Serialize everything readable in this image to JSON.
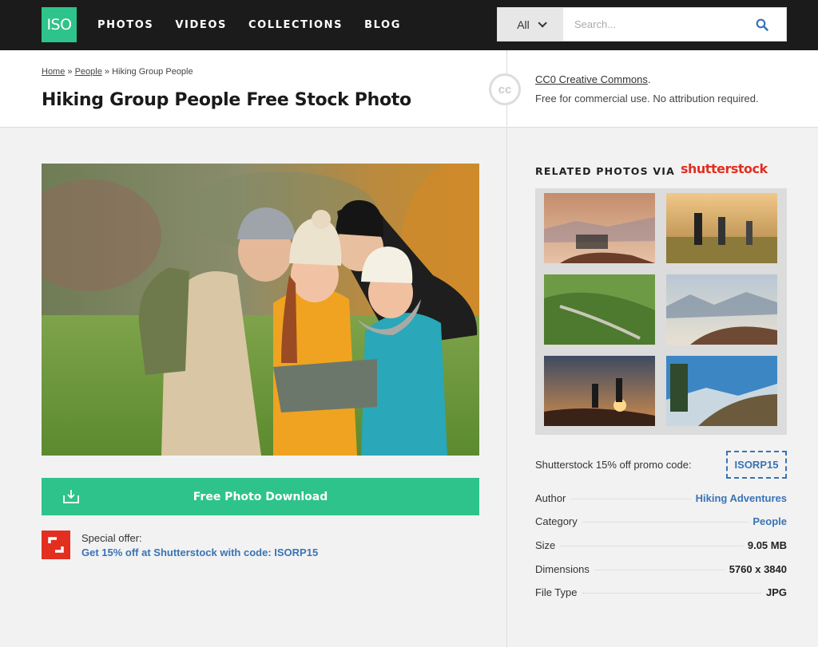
{
  "header": {
    "logo_text": "ISO",
    "nav": [
      "PHOTOS",
      "VIDEOS",
      "COLLECTIONS",
      "BLOG"
    ],
    "search": {
      "category": "All",
      "placeholder": "Search..."
    }
  },
  "breadcrumb": {
    "home": "Home",
    "sep": "»",
    "people": "People",
    "current": "Hiking Group People"
  },
  "page_title": "Hiking Group People Free Stock Photo",
  "license": {
    "icon_text": "cc",
    "link": "CC0 Creative Commons",
    "link_suffix": ".",
    "note": "Free for commercial use. No attribution required."
  },
  "download": {
    "label": "Free Photo Download"
  },
  "offer": {
    "label": "Special offer:",
    "link": "Get 15% off at Shutterstock with code: ISORP15"
  },
  "sidebar": {
    "related_title": "RELATED PHOTOS VIA",
    "related_brand": "shutterstock",
    "promo_label": "Shutterstock 15% off promo code:",
    "promo_code": "ISORP15",
    "meta": [
      {
        "key": "Author",
        "value": "Hiking Adventures",
        "link": true
      },
      {
        "key": "Category",
        "value": "People",
        "link": true
      },
      {
        "key": "Size",
        "value": "9.05 MB",
        "link": false
      },
      {
        "key": "Dimensions",
        "value": "5760 x 3840",
        "link": false
      },
      {
        "key": "File Type",
        "value": "JPG",
        "link": false
      }
    ]
  },
  "colors": {
    "brand_green": "#2ec38a",
    "link_blue": "#3a73b4",
    "shutterstock_red": "#e22f20",
    "topbar": "#1b1b1b"
  }
}
